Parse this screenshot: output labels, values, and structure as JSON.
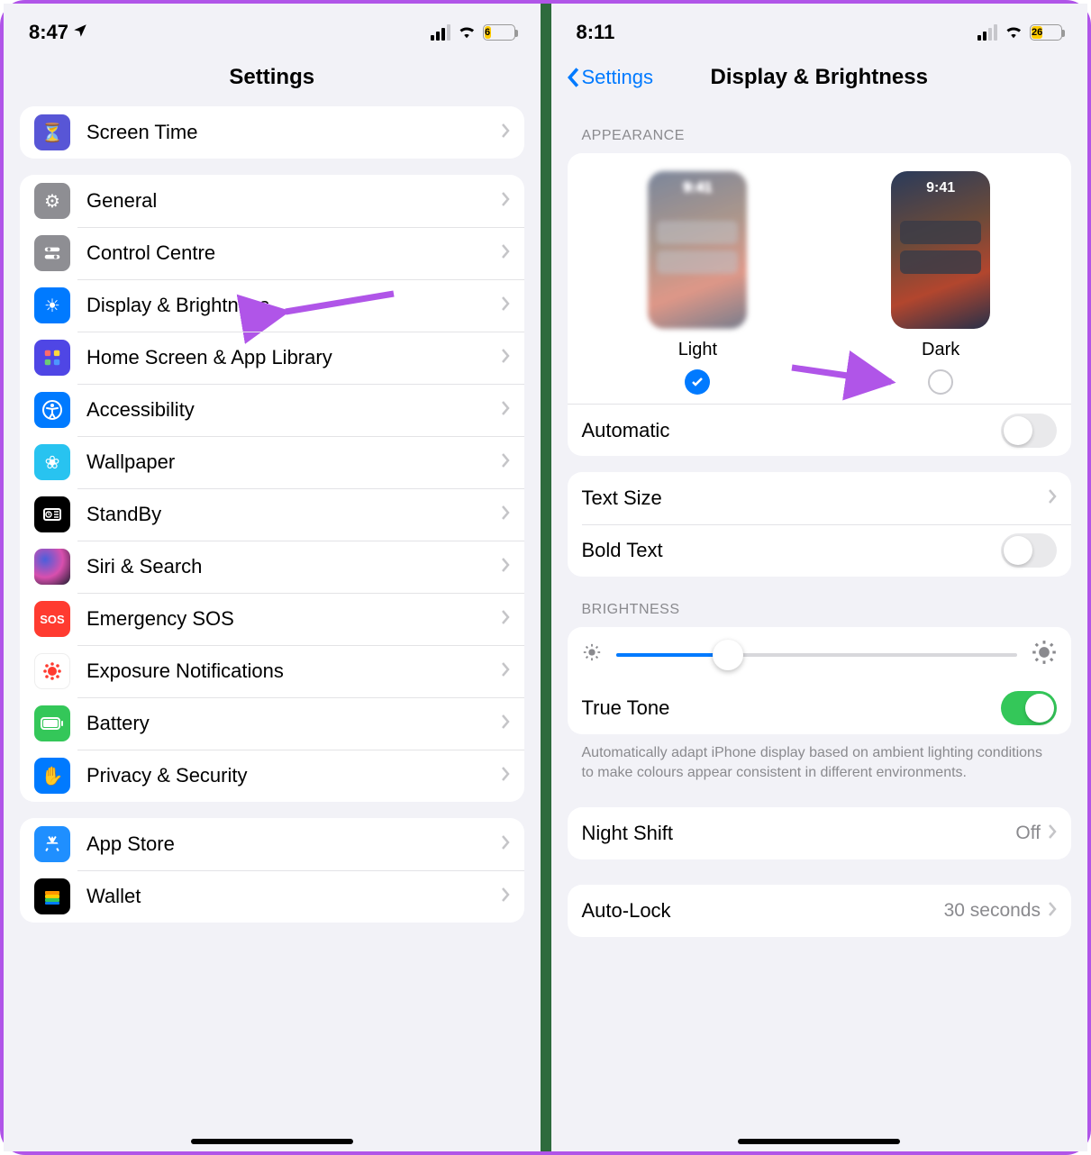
{
  "left": {
    "status": {
      "time": "8:47",
      "battery_pct": "6"
    },
    "title": "Settings",
    "group0": [
      {
        "label": "Screen Time",
        "icon": "hourglass-icon"
      }
    ],
    "group1": [
      {
        "label": "General",
        "icon": "gear-icon"
      },
      {
        "label": "Control Centre",
        "icon": "sliders-icon"
      },
      {
        "label": "Display & Brightness",
        "icon": "sun-icon"
      },
      {
        "label": "Home Screen & App Library",
        "icon": "grid-icon"
      },
      {
        "label": "Accessibility",
        "icon": "accessibility-icon"
      },
      {
        "label": "Wallpaper",
        "icon": "flower-icon"
      },
      {
        "label": "StandBy",
        "icon": "clock-icon"
      },
      {
        "label": "Siri & Search",
        "icon": "siri-icon"
      },
      {
        "label": "Emergency SOS",
        "icon": "sos-icon"
      },
      {
        "label": "Exposure Notifications",
        "icon": "exposure-icon"
      },
      {
        "label": "Battery",
        "icon": "battery-icon"
      },
      {
        "label": "Privacy & Security",
        "icon": "hand-icon"
      }
    ],
    "group2": [
      {
        "label": "App Store",
        "icon": "appstore-icon"
      },
      {
        "label": "Wallet",
        "icon": "wallet-icon"
      }
    ]
  },
  "right": {
    "status": {
      "time": "8:11",
      "battery_pct": "26"
    },
    "back": "Settings",
    "title": "Display & Brightness",
    "appearance_header": "APPEARANCE",
    "preview_clock": "9:41",
    "light_label": "Light",
    "dark_label": "Dark",
    "automatic_label": "Automatic",
    "automatic_on": false,
    "text_size_label": "Text Size",
    "bold_text_label": "Bold Text",
    "bold_text_on": false,
    "brightness_header": "BRIGHTNESS",
    "brightness_pct": 28,
    "true_tone_label": "True Tone",
    "true_tone_on": true,
    "true_tone_footer": "Automatically adapt iPhone display based on ambient lighting conditions to make colours appear consistent in different environments.",
    "night_shift_label": "Night Shift",
    "night_shift_value": "Off",
    "auto_lock_label": "Auto-Lock",
    "auto_lock_value": "30 seconds"
  }
}
